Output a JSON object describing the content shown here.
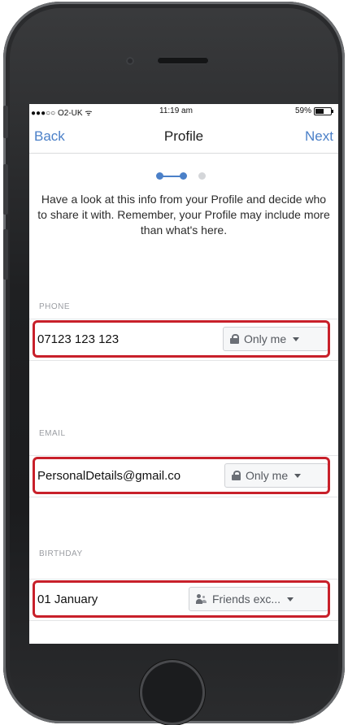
{
  "status_bar": {
    "carrier": "●●●○○ O2-UK ᯤ",
    "time": "11:19 am",
    "battery": "59%"
  },
  "nav": {
    "back_label": "Back",
    "title": "Profile",
    "next_label": "Next"
  },
  "progress": {
    "current_step": 2,
    "total_steps": 3
  },
  "intro_text": "Have a look at this info from your Profile and decide who to share it with. Remember, your Profile may include more than what's here.",
  "fields": [
    {
      "label": "PHONE",
      "value": "07123 123 123",
      "audience": "Only me",
      "audience_icon": "lock-icon"
    },
    {
      "label": "EMAIL",
      "value": "PersonalDetails@gmail.co",
      "audience": "Only me",
      "audience_icon": "lock-icon"
    },
    {
      "label": "BIRTHDAY",
      "value": "01 January",
      "audience": "Friends exc...",
      "audience_icon": "friends-icon"
    }
  ],
  "colors": {
    "accent": "#4b80c8",
    "highlight": "#c8202a"
  }
}
